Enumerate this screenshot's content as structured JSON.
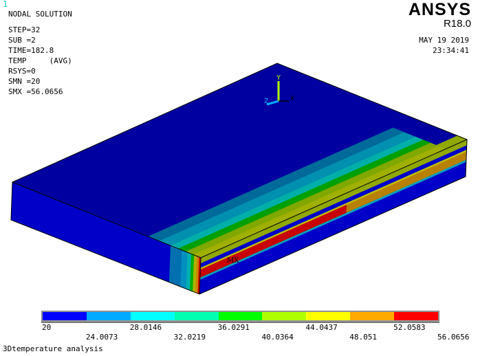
{
  "window_number": "1",
  "info": {
    "title": "NODAL SOLUTION",
    "lines": [
      "STEP=32",
      "SUB =2",
      "TIME=182.8",
      "TEMP     (AVG)",
      "RSYS=0",
      "SMN =20",
      "SMX =56.0656"
    ]
  },
  "brand": {
    "logo": "ANSYS",
    "version": "R18.0",
    "date": "MAY 19 2019",
    "time": "23:34:41"
  },
  "triad": {
    "y": "Y",
    "x": "X",
    "z": "Z"
  },
  "max_marker": "MX",
  "legend": {
    "colors": [
      "#0000ff",
      "#00aaff",
      "#00ffff",
      "#00ffb0",
      "#00ff00",
      "#b0ff00",
      "#ffff00",
      "#ffaa00",
      "#ff0000"
    ],
    "labels_top": [
      "20",
      "28.0146",
      "36.0291",
      "44.0437",
      "52.0583"
    ],
    "labels_bottom": [
      "24.0073",
      "32.0219",
      "40.0364",
      "48.051",
      "56.0656"
    ]
  },
  "footer_title": "3Dtemperature analysis"
}
